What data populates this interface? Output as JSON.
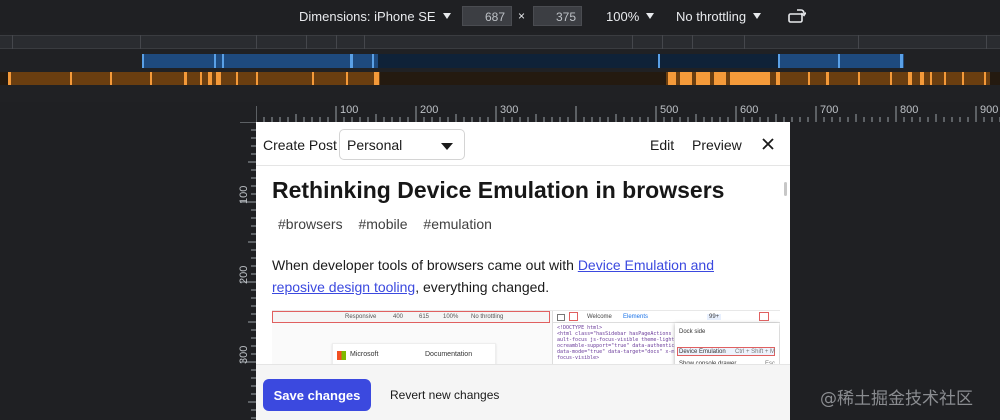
{
  "devtools_toolbar": {
    "dimensions_label": "Dimensions: iPhone SE",
    "width_value": "687",
    "height_value": "375",
    "times_sign": "×",
    "zoom_label": "100%",
    "throttling_label": "No throttling",
    "rotate_icon": "rotate-icon"
  },
  "ruler": {
    "horizontal_labels": [
      "100",
      "200",
      "300",
      "500",
      "600",
      "700",
      "800",
      "900"
    ],
    "vertical_labels": [
      "100",
      "200",
      "300"
    ]
  },
  "page": {
    "header": {
      "title": "Create Post",
      "select_value": "Personal",
      "edit_label": "Edit",
      "preview_label": "Preview",
      "close_icon": "close-icon"
    },
    "article": {
      "heading": "Rethinking Device Emulation in browsers",
      "tags": [
        "#browsers",
        "#mobile",
        "#emulation"
      ],
      "para_before": "When developer tools of browsers came out with ",
      "link_text": "Device Emulation and reposive design tooling",
      "para_after": ", everything changed."
    },
    "screenshot": {
      "bar_responsive": "Responsive",
      "bar_width": "400",
      "bar_height": "615",
      "bar_zoom": "100%",
      "bar_throttle": "No throttling",
      "site_name": "Microsoft",
      "site_nav": "Documentation",
      "tab_welcome": "Welcome",
      "tab_elements": "Elements",
      "badge": "99+",
      "code_lines": [
        "<!DOCTYPE html>",
        "<html class=\"hasSidebar hasPageActions",
        "ault-focus js-focus-visible theme-light\"",
        "ocreamble-support=\"true\" data-authenticate",
        "data-mode=\"true\" data-target=\"docs\" x-ms",
        "focus-visible>"
      ],
      "menu_dock": "Dock side",
      "menu_device": "Device Emulation",
      "menu_shortcut": "Ctrl + Shift + M",
      "menu_console": "Show console drawer",
      "menu_esc": "Esc"
    },
    "footer": {
      "save_label": "Save changes",
      "revert_label": "Revert new changes"
    }
  },
  "watermark": "@稀土掘金技术社区",
  "colors": {
    "accent": "#3b49df",
    "devtools_bg": "#1f2023",
    "timeline_blue": "#5aa0e6",
    "timeline_orange": "#f49a3a"
  }
}
